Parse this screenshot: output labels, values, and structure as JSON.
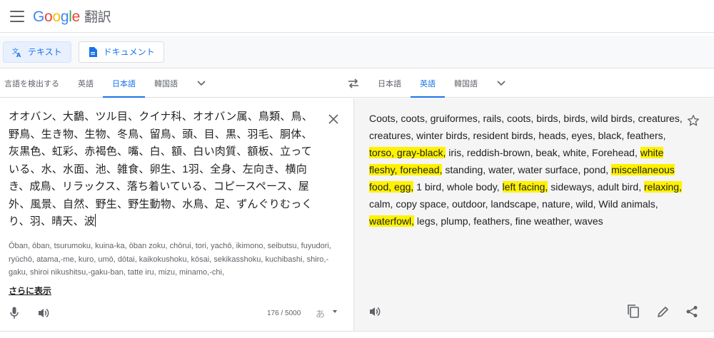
{
  "header": {
    "logo": [
      "G",
      "o",
      "o",
      "g",
      "l",
      "e"
    ],
    "product": "翻訳"
  },
  "modes": [
    {
      "label": "テキスト",
      "icon": "translate-icon",
      "active": true
    },
    {
      "label": "ドキュメント",
      "icon": "document-icon",
      "active": false
    }
  ],
  "source_langs": [
    "言語を検出する",
    "英語",
    "日本語",
    "韓国語"
  ],
  "source_active": "日本語",
  "target_langs": [
    "日本語",
    "英語",
    "韓国語"
  ],
  "target_active": "英語",
  "source": {
    "text": "オオバン、大鷭、ツル目、クイナ科、オオバン属、鳥類、鳥、野鳥、生き物、生物、冬鳥、留鳥、頭、目、黒、羽毛、胴体、灰黒色、虹彩、赤褐色、嘴、白、額、白い肉質、額板、立っている、水、水面、池、雑食、卵生、1羽、全身、左向き、横向き、成鳥、リラックス、落ち着いている、コピースペース、屋外、風景、自然、野生、野生動物、水鳥、足、ずんぐりむっくり、羽、晴天、波",
    "romaji": "Ōban, ōban, tsurumoku, kuina-ka, ōban zoku, chōrui, tori, yachō, ikimono, seibutsu, fuyudori, ryūchō, atama,-me, kuro, umō, dōtai, kaikokushoku, kōsai, sekikasshoku, kuchibashi, shiro,-gaku, shiroi nikushitsu,-gaku-ban, tatte iru, mizu, minamo,-chi,",
    "show_more": "さらに表示",
    "count": "176 / 5000",
    "ime": "あ"
  },
  "target": {
    "segments": [
      {
        "t": "Coots, coots, gruiformes, rails, coots, birds, birds, wild birds, creatures, creatures, winter birds, resident birds, heads, eyes, black, feathers, ",
        "h": false
      },
      {
        "t": "torso, gray-black,",
        "h": true
      },
      {
        "t": " iris, reddish-brown, beak, white, Forehead, ",
        "h": false
      },
      {
        "t": "white fleshy, forehead,",
        "h": true
      },
      {
        "t": " standing, water, water surface, pond, ",
        "h": false
      },
      {
        "t": "miscellaneous food, egg,",
        "h": true
      },
      {
        "t": " 1 bird, whole body, ",
        "h": false
      },
      {
        "t": "left facing,",
        "h": true
      },
      {
        "t": " sideways, adult bird, ",
        "h": false
      },
      {
        "t": "relaxing,",
        "h": true
      },
      {
        "t": " calm, copy space, outdoor, landscape, nature, wild, Wild animals, ",
        "h": false
      },
      {
        "t": "waterfowl,",
        "h": true
      },
      {
        "t": " legs, plump, feathers, fine weather, waves",
        "h": false
      }
    ]
  },
  "colors": {
    "accent": "#1a73e8",
    "highlight": "#fff200"
  }
}
